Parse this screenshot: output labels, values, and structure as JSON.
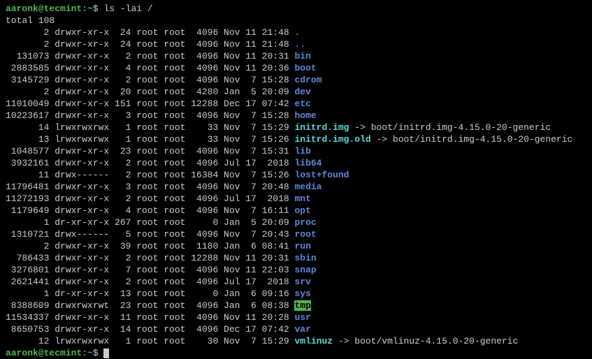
{
  "prompt": {
    "user": "aaronk",
    "sep": "@",
    "host": "tecmint",
    "colon": ":",
    "path": "~",
    "dollar": "$ "
  },
  "command": "ls -lai /",
  "total_line": "total 108",
  "rows": [
    {
      "inode": "       2",
      "perms": " drwxr-xr-x ",
      "links": " 24",
      "owner": " root",
      "group": " root",
      "size": "  4096",
      "date": " Nov 11 21:48 ",
      "name": ".",
      "cls": "dir",
      "suffix": ""
    },
    {
      "inode": "       2",
      "perms": " drwxr-xr-x ",
      "links": " 24",
      "owner": " root",
      "group": " root",
      "size": "  4096",
      "date": " Nov 11 21:48 ",
      "name": "..",
      "cls": "dir",
      "suffix": ""
    },
    {
      "inode": "  131073",
      "perms": " drwxr-xr-x ",
      "links": "  2",
      "owner": " root",
      "group": " root",
      "size": "  4096",
      "date": " Nov 11 20:31 ",
      "name": "bin",
      "cls": "dir",
      "suffix": ""
    },
    {
      "inode": " 2883585",
      "perms": " drwxr-xr-x ",
      "links": "  4",
      "owner": " root",
      "group": " root",
      "size": "  4096",
      "date": " Nov 11 20:36 ",
      "name": "boot",
      "cls": "dir",
      "suffix": ""
    },
    {
      "inode": " 3145729",
      "perms": " drwxr-xr-x ",
      "links": "  2",
      "owner": " root",
      "group": " root",
      "size": "  4096",
      "date": " Nov  7 15:28 ",
      "name": "cdrom",
      "cls": "dir",
      "suffix": ""
    },
    {
      "inode": "       2",
      "perms": " drwxr-xr-x ",
      "links": " 20",
      "owner": " root",
      "group": " root",
      "size": "  4280",
      "date": " Jan  5 20:09 ",
      "name": "dev",
      "cls": "dir",
      "suffix": ""
    },
    {
      "inode": "11010049",
      "perms": " drwxr-xr-x ",
      "links": "151",
      "owner": " root",
      "group": " root",
      "size": " 12288",
      "date": " Dec 17 07:42 ",
      "name": "etc",
      "cls": "dir",
      "suffix": ""
    },
    {
      "inode": "10223617",
      "perms": " drwxr-xr-x ",
      "links": "  3",
      "owner": " root",
      "group": " root",
      "size": "  4096",
      "date": " Nov  7 15:28 ",
      "name": "home",
      "cls": "dir",
      "suffix": ""
    },
    {
      "inode": "      14",
      "perms": " lrwxrwxrwx ",
      "links": "  1",
      "owner": " root",
      "group": " root",
      "size": "    33",
      "date": " Nov  7 15:29 ",
      "name": "initrd.img",
      "cls": "sym",
      "suffix": " -> boot/initrd.img-4.15.0-20-generic"
    },
    {
      "inode": "      13",
      "perms": " lrwxrwxrwx ",
      "links": "  1",
      "owner": " root",
      "group": " root",
      "size": "    33",
      "date": " Nov  7 15:26 ",
      "name": "initrd.img.old",
      "cls": "sym",
      "suffix": " -> boot/initrd.img-4.15.0-20-generic"
    },
    {
      "inode": " 1048577",
      "perms": " drwxr-xr-x ",
      "links": " 23",
      "owner": " root",
      "group": " root",
      "size": "  4096",
      "date": " Nov  7 15:31 ",
      "name": "lib",
      "cls": "dir",
      "suffix": ""
    },
    {
      "inode": " 3932161",
      "perms": " drwxr-xr-x ",
      "links": "  2",
      "owner": " root",
      "group": " root",
      "size": "  4096",
      "date": " Jul 17  2018 ",
      "name": "lib64",
      "cls": "dir",
      "suffix": ""
    },
    {
      "inode": "      11",
      "perms": " drwx------ ",
      "links": "  2",
      "owner": " root",
      "group": " root",
      "size": " 16384",
      "date": " Nov  7 15:26 ",
      "name": "lost+found",
      "cls": "dir",
      "suffix": ""
    },
    {
      "inode": "11796481",
      "perms": " drwxr-xr-x ",
      "links": "  3",
      "owner": " root",
      "group": " root",
      "size": "  4096",
      "date": " Nov  7 20:48 ",
      "name": "media",
      "cls": "dir",
      "suffix": ""
    },
    {
      "inode": "11272193",
      "perms": " drwxr-xr-x ",
      "links": "  2",
      "owner": " root",
      "group": " root",
      "size": "  4096",
      "date": " Jul 17  2018 ",
      "name": "mnt",
      "cls": "dir",
      "suffix": ""
    },
    {
      "inode": " 1179649",
      "perms": " drwxr-xr-x ",
      "links": "  4",
      "owner": " root",
      "group": " root",
      "size": "  4096",
      "date": " Nov  7 16:11 ",
      "name": "opt",
      "cls": "dir",
      "suffix": ""
    },
    {
      "inode": "       1",
      "perms": " dr-xr-xr-x ",
      "links": "267",
      "owner": " root",
      "group": " root",
      "size": "     0",
      "date": " Jan  5 20:09 ",
      "name": "proc",
      "cls": "dir",
      "suffix": ""
    },
    {
      "inode": " 1310721",
      "perms": " drwx------ ",
      "links": "  5",
      "owner": " root",
      "group": " root",
      "size": "  4096",
      "date": " Nov  7 20:43 ",
      "name": "root",
      "cls": "dir",
      "suffix": ""
    },
    {
      "inode": "       2",
      "perms": " drwxr-xr-x ",
      "links": " 39",
      "owner": " root",
      "group": " root",
      "size": "  1180",
      "date": " Jan  6 08:41 ",
      "name": "run",
      "cls": "dir",
      "suffix": ""
    },
    {
      "inode": "  786433",
      "perms": " drwxr-xr-x ",
      "links": "  2",
      "owner": " root",
      "group": " root",
      "size": " 12288",
      "date": " Nov 11 20:31 ",
      "name": "sbin",
      "cls": "dir",
      "suffix": ""
    },
    {
      "inode": " 3276801",
      "perms": " drwxr-xr-x ",
      "links": "  7",
      "owner": " root",
      "group": " root",
      "size": "  4096",
      "date": " Nov 11 22:03 ",
      "name": "snap",
      "cls": "dir",
      "suffix": ""
    },
    {
      "inode": " 2621441",
      "perms": " drwxr-xr-x ",
      "links": "  2",
      "owner": " root",
      "group": " root",
      "size": "  4096",
      "date": " Jul 17  2018 ",
      "name": "srv",
      "cls": "dir",
      "suffix": ""
    },
    {
      "inode": "       1",
      "perms": " dr-xr-xr-x ",
      "links": " 13",
      "owner": " root",
      "group": " root",
      "size": "     0",
      "date": " Jan  6 09:16 ",
      "name": "sys",
      "cls": "dir",
      "suffix": ""
    },
    {
      "inode": " 8388609",
      "perms": " drwxrwxrwt ",
      "links": " 23",
      "owner": " root",
      "group": " root",
      "size": "  4096",
      "date": " Jan  6 08:38 ",
      "name": "tmp",
      "cls": "sticky",
      "suffix": ""
    },
    {
      "inode": "11534337",
      "perms": " drwxr-xr-x ",
      "links": " 11",
      "owner": " root",
      "group": " root",
      "size": "  4096",
      "date": " Nov 11 20:28 ",
      "name": "usr",
      "cls": "dir",
      "suffix": ""
    },
    {
      "inode": " 8650753",
      "perms": " drwxr-xr-x ",
      "links": " 14",
      "owner": " root",
      "group": " root",
      "size": "  4096",
      "date": " Dec 17 07:42 ",
      "name": "var",
      "cls": "dir",
      "suffix": ""
    },
    {
      "inode": "      12",
      "perms": " lrwxrwxrwx ",
      "links": "  1",
      "owner": " root",
      "group": " root",
      "size": "    30",
      "date": " Nov  7 15:29 ",
      "name": "vmlinuz",
      "cls": "sym",
      "suffix": " -> boot/vmlinuz-4.15.0-20-generic"
    }
  ]
}
